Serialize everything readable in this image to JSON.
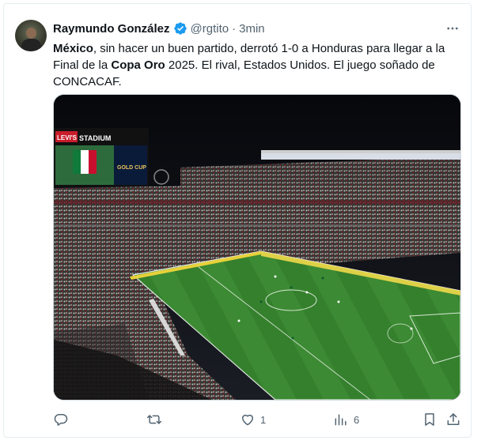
{
  "author": {
    "name": "Raymundo González",
    "handle": "@rgtito",
    "separator": "·",
    "time": "3min"
  },
  "tweet": {
    "segments": [
      {
        "text": "México",
        "bold": true
      },
      {
        "text": ", sin hacer un buen partido, derrotó 1-0 a Honduras para llegar a la Final de la ",
        "bold": false
      },
      {
        "text": "Copa Oro",
        "bold": true
      },
      {
        "text": " 2025. El rival, Estados Unidos. El juego soñado de CONCACAF.",
        "bold": false
      }
    ]
  },
  "media": {
    "stadium_sign": "STADIUM",
    "sign_prefix": "LEVI'S",
    "board_text": "GOLD CUP"
  },
  "actions": {
    "reply_count": "",
    "retweet_count": "",
    "like_count": "1",
    "views_count": "6"
  },
  "colors": {
    "verified": "#1d9bf0",
    "text_secondary": "#536471",
    "pitch": "#2f7a2a"
  },
  "icons": [
    "verified-badge-icon",
    "more-icon",
    "reply-icon",
    "retweet-icon",
    "like-icon",
    "views-icon",
    "bookmark-icon",
    "share-icon"
  ]
}
